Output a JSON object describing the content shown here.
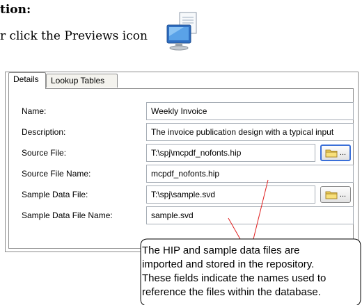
{
  "doc": {
    "heading": "tion:",
    "instruction": "r click the Previews icon",
    "previews_icon": "previews-monitor-icon"
  },
  "tabs": [
    {
      "label": "Details",
      "active": true
    },
    {
      "label": "Lookup Tables",
      "active": false
    }
  ],
  "fields": {
    "name": {
      "label": "Name:",
      "value": "Weekly Invoice"
    },
    "description": {
      "label": "Description:",
      "value": "The invoice publication design with a typical input"
    },
    "source_file": {
      "label": "Source File:",
      "value": "T:\\spj\\mcpdf_nofonts.hip"
    },
    "source_file_name": {
      "label": "Source File Name:",
      "value": "mcpdf_nofonts.hip"
    },
    "sample_data_file": {
      "label": "Sample Data File:",
      "value": "T:\\spj\\sample.svd"
    },
    "sample_data_file_name": {
      "label": "Sample Data File Name:",
      "value": "sample.svd"
    }
  },
  "browse_button": {
    "label": "...",
    "icon": "folder-icon"
  },
  "callout": {
    "lines": [
      "The HIP and sample data files are",
      "imported and stored in the repository.",
      "These fields indicate the names used to",
      "reference the files within the database."
    ],
    "accent": "#e02020"
  }
}
